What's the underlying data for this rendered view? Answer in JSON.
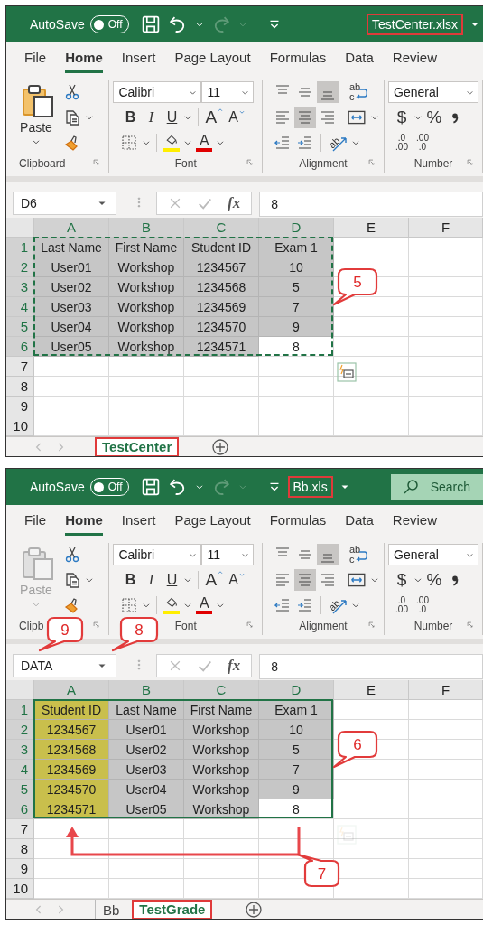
{
  "windows": [
    {
      "title_bar": {
        "autosave": {
          "label": "AutoSave",
          "toggle": "Off",
          "on": false
        },
        "redo_disabled": true,
        "file_name": {
          "text": "TestCenter.xlsx",
          "highlighted": true
        }
      },
      "ribbon_tabs": [
        {
          "label": "File",
          "selected": false
        },
        {
          "label": "Home",
          "selected": true
        },
        {
          "label": "Insert",
          "selected": false
        },
        {
          "label": "Page Layout",
          "selected": false
        },
        {
          "label": "Formulas",
          "selected": false
        },
        {
          "label": "Data",
          "selected": false
        },
        {
          "label": "Review",
          "selected": false
        }
      ],
      "ribbon": {
        "paste": {
          "label": "Paste",
          "disabled": false
        },
        "font_name": "Calibri",
        "font_size": "11",
        "bold": "B",
        "italic": "I",
        "underline": "U",
        "grow_font": "A",
        "shrink_font": "A",
        "font_color": "A",
        "alignment": [
          {
            "kind": "top",
            "selected": false
          },
          {
            "kind": "middle",
            "selected": false
          },
          {
            "kind": "bottom",
            "selected": true
          },
          {
            "kind": "left",
            "selected": false
          },
          {
            "kind": "center",
            "selected": true
          },
          {
            "kind": "right",
            "selected": false
          }
        ],
        "wrap_text": [
          "ab",
          "c"
        ],
        "orientation": "ab",
        "number_format": "General",
        "currency": "$",
        "percent": "%",
        "decimals": [
          [
            ".0",
            ".00"
          ],
          [
            ".00",
            ".0"
          ]
        ],
        "groups": [
          "Clipboard",
          "Font",
          "Alignment",
          "Number"
        ]
      },
      "formula_bar": {
        "name_box": "D6",
        "fx": "fx",
        "value": "8"
      },
      "columns": [
        {
          "label": "A",
          "selected": true
        },
        {
          "label": "B",
          "selected": true
        },
        {
          "label": "C",
          "selected": true
        },
        {
          "label": "D",
          "selected": true
        },
        {
          "label": "E",
          "selected": false
        },
        {
          "label": "F",
          "selected": false
        }
      ],
      "rows": [
        {
          "number": "1",
          "selected": true,
          "cells": [
            {
              "text": "Last Name",
              "selected": true,
              "highlighted": false
            },
            {
              "text": "First Name",
              "selected": true,
              "highlighted": false
            },
            {
              "text": "Student ID",
              "selected": true,
              "highlighted": false
            },
            {
              "text": "Exam 1",
              "selected": true,
              "highlighted": false
            }
          ]
        },
        {
          "number": "2",
          "selected": true,
          "cells": [
            {
              "text": "User01",
              "selected": true,
              "highlighted": false
            },
            {
              "text": "Workshop",
              "selected": true,
              "highlighted": false
            },
            {
              "text": "1234567",
              "selected": true,
              "highlighted": false
            },
            {
              "text": "10",
              "selected": true,
              "highlighted": false
            }
          ]
        },
        {
          "number": "3",
          "selected": true,
          "cells": [
            {
              "text": "User02",
              "selected": true,
              "highlighted": false
            },
            {
              "text": "Workshop",
              "selected": true,
              "highlighted": false
            },
            {
              "text": "1234568",
              "selected": true,
              "highlighted": false
            },
            {
              "text": "5",
              "selected": true,
              "highlighted": false
            }
          ]
        },
        {
          "number": "4",
          "selected": true,
          "cells": [
            {
              "text": "User03",
              "selected": true,
              "highlighted": false
            },
            {
              "text": "Workshop",
              "selected": true,
              "highlighted": false
            },
            {
              "text": "1234569",
              "selected": true,
              "highlighted": false
            },
            {
              "text": "7",
              "selected": true,
              "highlighted": false
            }
          ]
        },
        {
          "number": "5",
          "selected": true,
          "cells": [
            {
              "text": "User04",
              "selected": true,
              "highlighted": false
            },
            {
              "text": "Workshop",
              "selected": true,
              "highlighted": false
            },
            {
              "text": "1234570",
              "selected": true,
              "highlighted": false
            },
            {
              "text": "9",
              "selected": true,
              "highlighted": false
            }
          ]
        },
        {
          "number": "6",
          "selected": true,
          "cells": [
            {
              "text": "User05",
              "selected": true,
              "highlighted": false
            },
            {
              "text": "Workshop",
              "selected": true,
              "highlighted": false
            },
            {
              "text": "1234571",
              "selected": true,
              "highlighted": false
            },
            {
              "text": "8",
              "selected": false,
              "highlighted": false
            }
          ]
        },
        {
          "number": "7",
          "selected": false
        },
        {
          "number": "8",
          "selected": false
        },
        {
          "number": "9",
          "selected": false
        },
        {
          "number": "10",
          "selected": false
        }
      ],
      "selection": {
        "kind": "copy"
      },
      "paste_options": {
        "faded": false
      },
      "sheet_tabs": [
        {
          "label": "TestCenter",
          "selected": true,
          "highlighted": true
        }
      ],
      "callouts": [
        {
          "label": "5",
          "kind": "selection"
        }
      ]
    },
    {
      "title_bar": {
        "autosave": {
          "label": "AutoSave",
          "toggle": "Off",
          "on": false
        },
        "redo_disabled": true,
        "file_name": {
          "text": "Bb.xls",
          "highlighted": true
        },
        "search": {
          "placeholder": "Search"
        }
      },
      "ribbon_tabs": [
        {
          "label": "File",
          "selected": false
        },
        {
          "label": "Home",
          "selected": true
        },
        {
          "label": "Insert",
          "selected": false
        },
        {
          "label": "Page Layout",
          "selected": false
        },
        {
          "label": "Formulas",
          "selected": false
        },
        {
          "label": "Data",
          "selected": false
        },
        {
          "label": "Review",
          "selected": false
        }
      ],
      "ribbon": {
        "paste": {
          "label": "Paste",
          "disabled": true
        },
        "font_name": "Calibri",
        "font_size": "11",
        "bold": "B",
        "italic": "I",
        "underline": "U",
        "grow_font": "A",
        "shrink_font": "A",
        "font_color": "A",
        "alignment": [
          {
            "kind": "top",
            "selected": false
          },
          {
            "kind": "middle",
            "selected": false
          },
          {
            "kind": "bottom",
            "selected": true
          },
          {
            "kind": "left",
            "selected": false
          },
          {
            "kind": "center",
            "selected": true
          },
          {
            "kind": "right",
            "selected": false
          }
        ],
        "wrap_text": [
          "ab",
          "c"
        ],
        "orientation": "ab",
        "number_format": "General",
        "currency": "$",
        "percent": "%",
        "decimals": [
          [
            ".0",
            ".00"
          ],
          [
            ".00",
            ".0"
          ]
        ],
        "groups": [
          "Clipb",
          "Font",
          "Alignment",
          "Number"
        ]
      },
      "formula_bar": {
        "name_box": "DATA",
        "fx": "fx",
        "value": "8"
      },
      "columns": [
        {
          "label": "A",
          "selected": true
        },
        {
          "label": "B",
          "selected": true
        },
        {
          "label": "C",
          "selected": true
        },
        {
          "label": "D",
          "selected": true
        },
        {
          "label": "E",
          "selected": false
        },
        {
          "label": "F",
          "selected": false
        }
      ],
      "rows": [
        {
          "number": "1",
          "selected": true,
          "cells": [
            {
              "text": "Student ID",
              "selected": true,
              "highlighted": true
            },
            {
              "text": "Last Name",
              "selected": true,
              "highlighted": false
            },
            {
              "text": "First Name",
              "selected": true,
              "highlighted": false
            },
            {
              "text": "Exam 1",
              "selected": true,
              "highlighted": false
            }
          ]
        },
        {
          "number": "2",
          "selected": true,
          "cells": [
            {
              "text": "1234567",
              "selected": true,
              "highlighted": true
            },
            {
              "text": "User01",
              "selected": true,
              "highlighted": false
            },
            {
              "text": "Workshop",
              "selected": true,
              "highlighted": false
            },
            {
              "text": "10",
              "selected": true,
              "highlighted": false
            }
          ]
        },
        {
          "number": "3",
          "selected": true,
          "cells": [
            {
              "text": "1234568",
              "selected": true,
              "highlighted": true
            },
            {
              "text": "User02",
              "selected": true,
              "highlighted": false
            },
            {
              "text": "Workshop",
              "selected": true,
              "highlighted": false
            },
            {
              "text": "5",
              "selected": true,
              "highlighted": false
            }
          ]
        },
        {
          "number": "4",
          "selected": true,
          "cells": [
            {
              "text": "1234569",
              "selected": true,
              "highlighted": true
            },
            {
              "text": "User03",
              "selected": true,
              "highlighted": false
            },
            {
              "text": "Workshop",
              "selected": true,
              "highlighted": false
            },
            {
              "text": "7",
              "selected": true,
              "highlighted": false
            }
          ]
        },
        {
          "number": "5",
          "selected": true,
          "cells": [
            {
              "text": "1234570",
              "selected": true,
              "highlighted": true
            },
            {
              "text": "User04",
              "selected": true,
              "highlighted": false
            },
            {
              "text": "Workshop",
              "selected": true,
              "highlighted": false
            },
            {
              "text": "9",
              "selected": true,
              "highlighted": false
            }
          ]
        },
        {
          "number": "6",
          "selected": true,
          "cells": [
            {
              "text": "1234571",
              "selected": true,
              "highlighted": true
            },
            {
              "text": "User05",
              "selected": true,
              "highlighted": false
            },
            {
              "text": "Workshop",
              "selected": true,
              "highlighted": false
            },
            {
              "text": "8",
              "selected": false,
              "highlighted": false
            }
          ]
        },
        {
          "number": "7",
          "selected": false
        },
        {
          "number": "8",
          "selected": false
        },
        {
          "number": "9",
          "selected": false
        },
        {
          "number": "10",
          "selected": false
        }
      ],
      "selection": {
        "kind": "solid"
      },
      "paste_options": {
        "faded": true
      },
      "sheet_tabs": [
        {
          "label": "Bb",
          "selected": false,
          "highlighted": false
        },
        {
          "label": "TestGrade",
          "selected": true,
          "highlighted": true
        }
      ],
      "callouts": [
        {
          "label": "9",
          "kind": "name_box"
        },
        {
          "label": "8",
          "kind": "name_box_caret"
        },
        {
          "label": "6",
          "kind": "selection"
        },
        {
          "label": "7",
          "kind": "arrow"
        }
      ]
    }
  ]
}
